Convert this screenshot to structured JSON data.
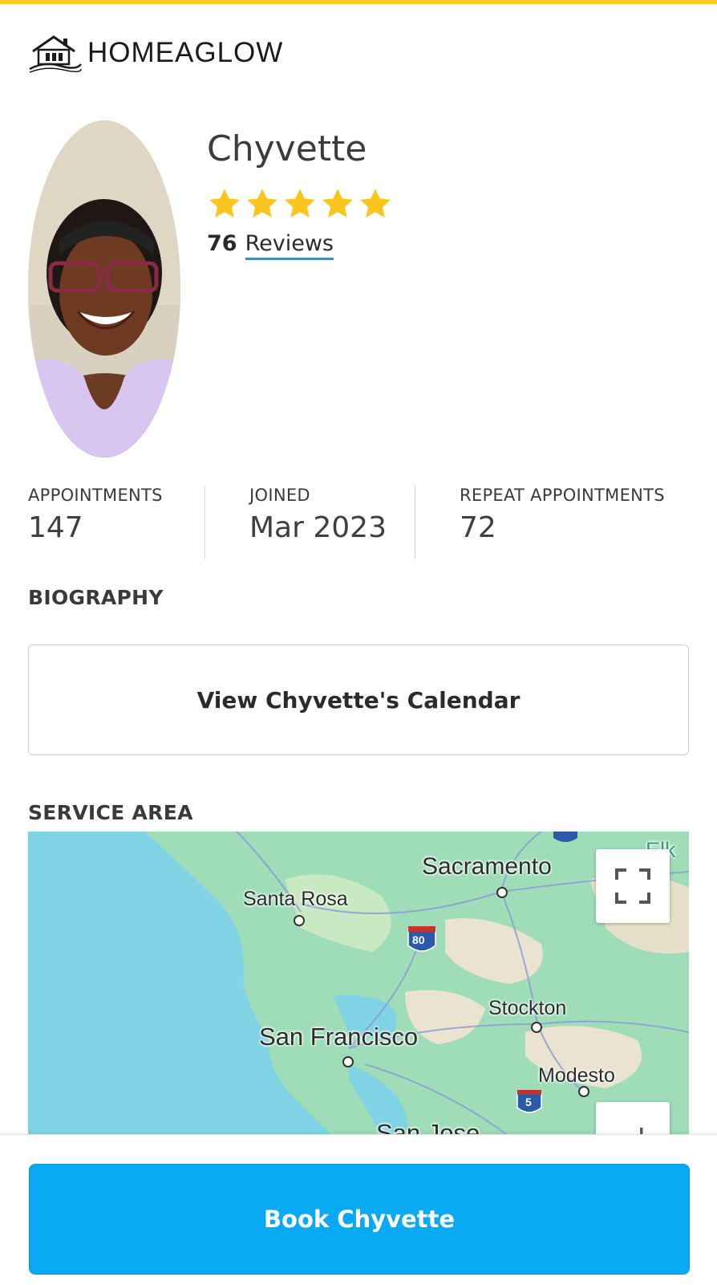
{
  "brand": {
    "name": "HOMEAGLOW",
    "accent_color": "#f7cc1d",
    "primary_button_color": "#09a9f4"
  },
  "profile": {
    "name": "Chyvette",
    "rating": 5,
    "rating_max": 5,
    "review_count": "76",
    "reviews_label": "Reviews",
    "avatar_icon": "person-photo"
  },
  "stats": [
    {
      "label": "APPOINTMENTS",
      "value": "147"
    },
    {
      "label": "JOINED",
      "value": "Mar 2023"
    },
    {
      "label": "REPEAT APPOINTMENTS",
      "value": "72"
    }
  ],
  "biography": {
    "title": "BIOGRAPHY"
  },
  "calendar_button": {
    "label": "View Chyvette's Calendar"
  },
  "service_area": {
    "title": "SERVICE AREA",
    "map_labels": {
      "sacramento": "Sacramento",
      "santa_rosa": "Santa Rosa",
      "stockton": "Stockton",
      "san_francisco": "San Francisco",
      "modesto": "Modesto",
      "san_jose": "San Jose",
      "elk_grove_partial": "Elk",
      "route_80": "80",
      "route_5": "5"
    },
    "fullscreen_icon": "fullscreen-icon",
    "zoom_icon": "zoom-in-icon"
  },
  "book_button": {
    "label": "Book Chyvette"
  }
}
